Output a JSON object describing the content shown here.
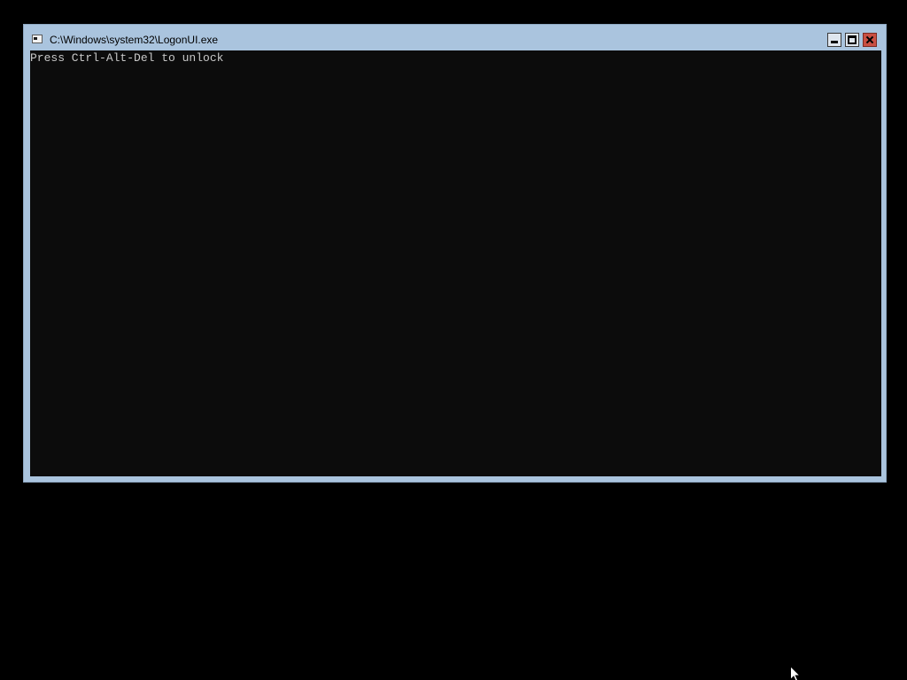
{
  "window": {
    "title": "C:\\Windows\\system32\\LogonUI.exe",
    "icon": "console-app-icon",
    "buttons": {
      "minimize": "minimize-icon",
      "maximize": "maximize-icon",
      "close": "close-icon"
    }
  },
  "console": {
    "lines": [
      "Press Ctrl-Alt-Del to unlock"
    ]
  },
  "colors": {
    "desktop": "#000000",
    "window_frame": "#aac4de",
    "console_background": "#0c0c0c",
    "console_text": "#c8c8c8",
    "close_button": "#c94f42"
  },
  "cursor": {
    "icon": "arrow-cursor-icon"
  }
}
